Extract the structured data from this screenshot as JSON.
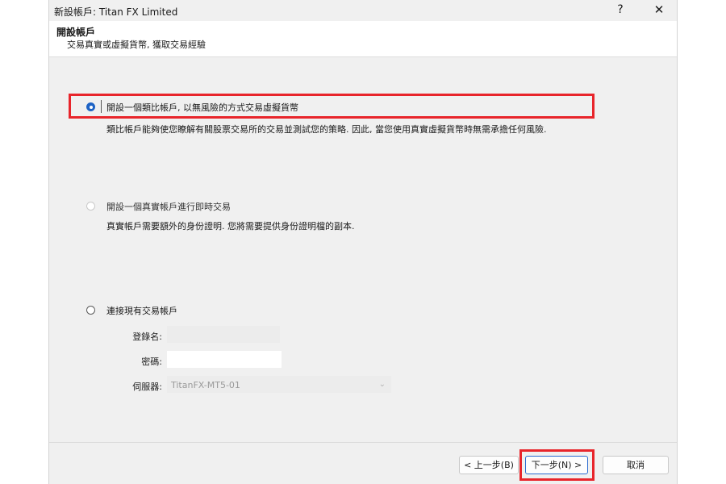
{
  "window": {
    "title": "新設帳戶: Titan FX Limited",
    "help_label": "?",
    "close_label": "✕"
  },
  "header": {
    "title": "開設帳戶",
    "subtitle": "交易真實或虛擬貨幣, 獲取交易經驗"
  },
  "options": [
    {
      "label": "開設一個類比帳戶, 以無風險的方式交易虛擬貨幣",
      "description": "類比帳戶能夠使您瞭解有關股票交易所的交易並測試您的策略. 因此, 當您使用真實虛擬貨幣時無需承擔任何風險.",
      "selected": true
    },
    {
      "label": "開設一個真實帳戶進行即時交易",
      "description": "真實帳戶需要額外的身份證明. 您將需要提供身份證明檔的副本.",
      "selected": false
    },
    {
      "label": "連接現有交易帳戶",
      "selected": false
    }
  ],
  "connect_form": {
    "login_label": "登錄名:",
    "login_value": "",
    "password_label": "密碼:",
    "password_value": "",
    "server_label": "伺服器:",
    "server_value": "TitanFX-MT5-01"
  },
  "buttons": {
    "back": "< 上一步(B)",
    "next": "下一步(N) >",
    "cancel": "取消"
  },
  "colors": {
    "highlight": "#e8252b",
    "radio_selected": "#1e63c5"
  }
}
